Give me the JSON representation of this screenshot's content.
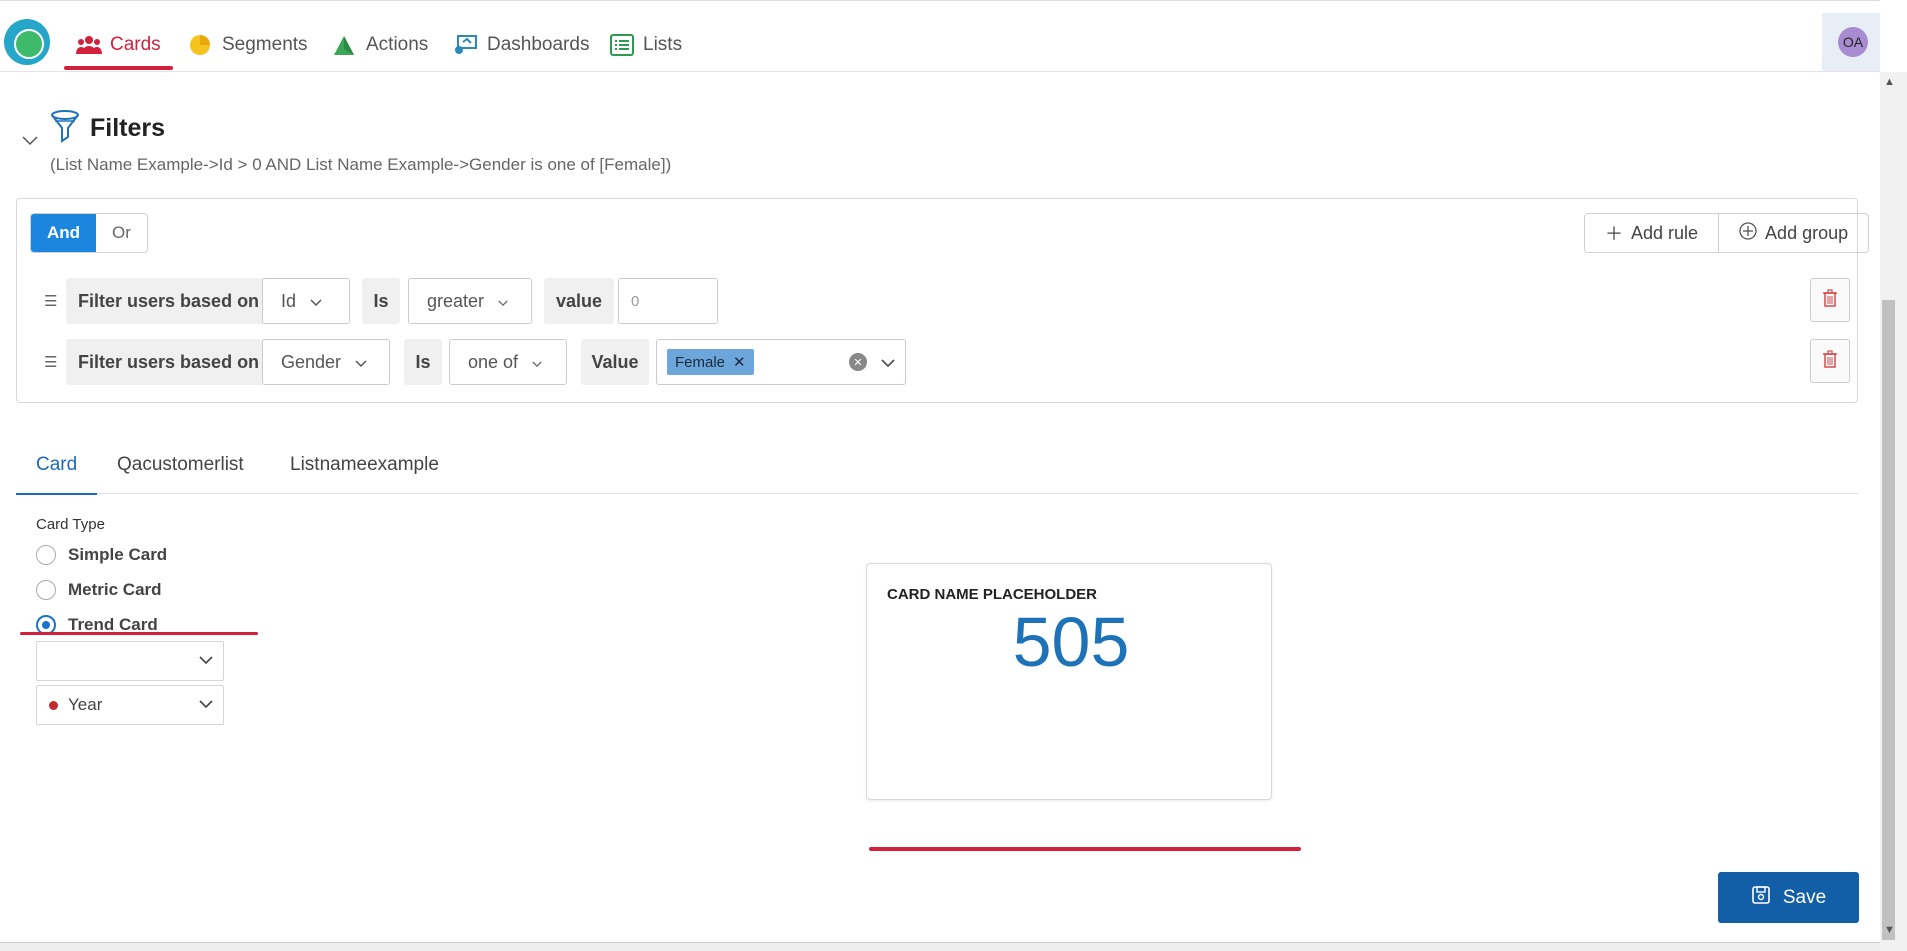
{
  "nav": {
    "tabs": [
      {
        "label": "Cards",
        "icon": "users-icon"
      },
      {
        "label": "Segments",
        "icon": "pie-chart-icon"
      },
      {
        "label": "Actions",
        "icon": "actions-icon"
      },
      {
        "label": "Dashboards",
        "icon": "dashboard-icon"
      },
      {
        "label": "Lists",
        "icon": "list-icon"
      }
    ],
    "active_color": "#d3203d",
    "avatar_initials": "OA"
  },
  "filters": {
    "title": "Filters",
    "summary": "(List Name Example->Id > 0 AND List Name Example->Gender is one of [Female])",
    "combinator": {
      "and_label": "And",
      "or_label": "Or",
      "selected": "And"
    },
    "add_rule_label": "Add rule",
    "add_group_label": "Add group",
    "rules": [
      {
        "prefix": "Filter users based on",
        "field": "Id",
        "op_label": "Is",
        "operator": "greater",
        "value_label": "value",
        "value_placeholder": "0"
      },
      {
        "prefix": "Filter users based on",
        "field": "Gender",
        "op_label": "Is",
        "operator": "one of",
        "value_label": "Value",
        "tags": [
          "Female"
        ]
      }
    ]
  },
  "content_tabs": {
    "items": [
      "Card",
      "Qacustomerlist",
      "Listnameexample"
    ],
    "active": "Card"
  },
  "card_type": {
    "label": "Card Type",
    "options": [
      "Simple Card",
      "Metric Card",
      "Trend Card"
    ],
    "selected": "Trend Card",
    "dropdown1_value": "",
    "dropdown2_value": "Year"
  },
  "card_preview": {
    "name": "CARD NAME PLACEHOLDER",
    "value": "505",
    "value_color": "#1e73b8"
  },
  "save_label": "Save"
}
